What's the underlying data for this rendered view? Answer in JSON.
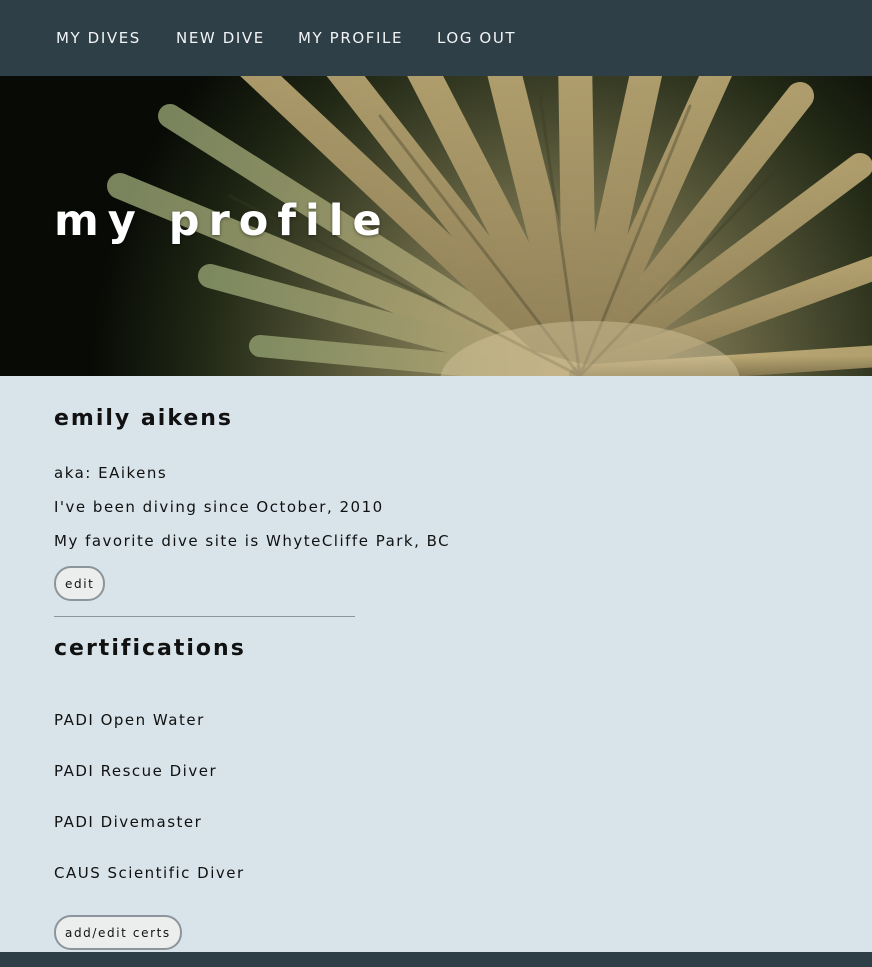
{
  "nav": {
    "items": [
      {
        "label": "MY DIVES"
      },
      {
        "label": "NEW DIVE"
      },
      {
        "label": "MY PROFILE"
      },
      {
        "label": "LOG OUT"
      }
    ]
  },
  "hero": {
    "title": "my profile"
  },
  "profile": {
    "name": "emily aikens",
    "aka": "aka: EAikens",
    "diving_since": "I've been diving since October, 2010",
    "favorite_site": "My favorite dive site is WhyteCliffe Park, BC",
    "edit_label": "edit"
  },
  "certifications": {
    "title": "certifications",
    "items": [
      {
        "label": "PADI Open Water"
      },
      {
        "label": "PADI Rescue Diver"
      },
      {
        "label": "PADI Divemaster"
      },
      {
        "label": "CAUS Scientific Diver"
      }
    ],
    "add_edit_label": "add/edit certs"
  },
  "colors": {
    "nav_bg": "#2e3f48",
    "page_bg": "#d8e4ea",
    "button_bg": "#eceeee"
  }
}
